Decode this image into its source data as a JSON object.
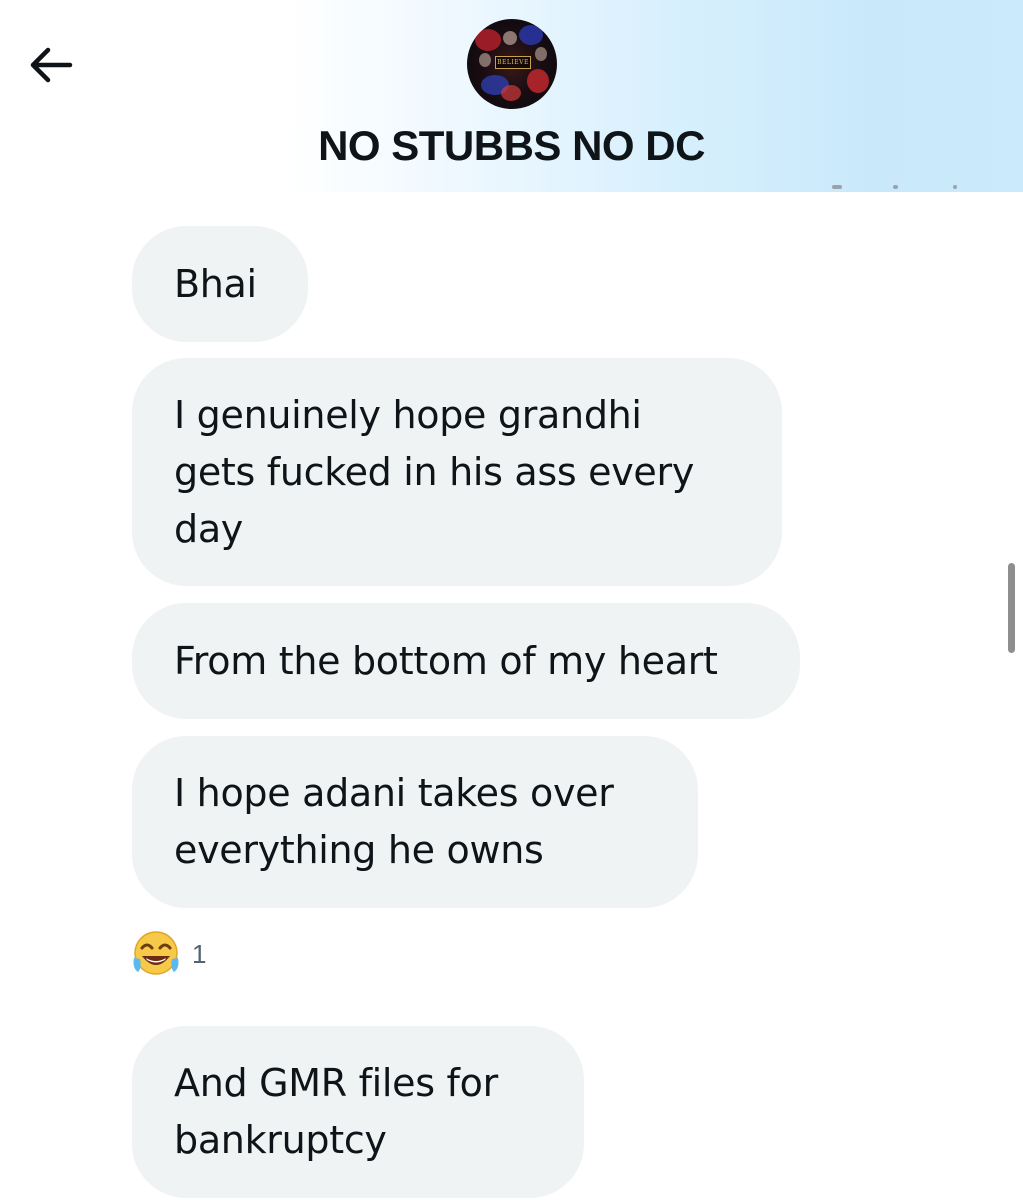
{
  "header": {
    "title": "NO STUBBS NO DC",
    "avatar_badge": "BELIEVE",
    "back_icon": "arrow-left-icon"
  },
  "messages": [
    {
      "text": "Bhai"
    },
    {
      "text": "I genuinely hope grandhi\ngets fucked in his ass every\nday"
    },
    {
      "text": "From the bottom of my heart"
    },
    {
      "text": "I hope adani takes over\neverything he owns"
    },
    {
      "text": "And GMR files for\nbankruptcy"
    }
  ],
  "reaction": {
    "emoji": "😂",
    "icon": "face-with-tears-of-joy-icon",
    "count": "1"
  },
  "colors": {
    "bubble_bg": "#eff3f4",
    "text": "#0f1419",
    "secondary_text": "#536471",
    "header_gradient_end": "#c9e9fb"
  }
}
